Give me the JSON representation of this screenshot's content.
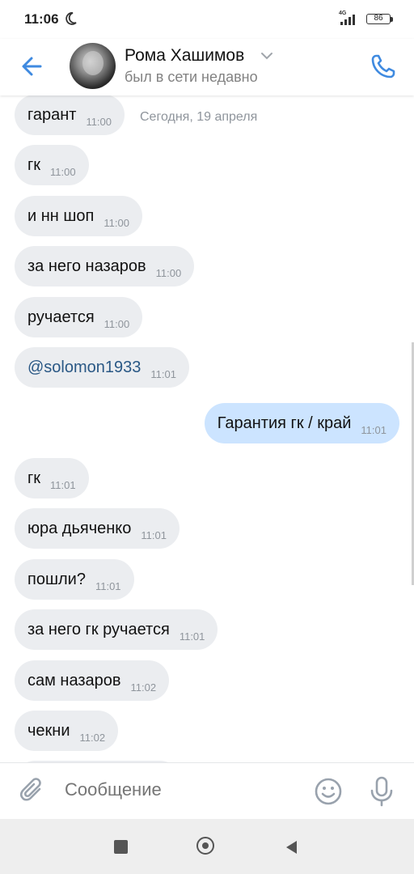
{
  "status_bar": {
    "time": "11:06",
    "network": "4G",
    "battery": "86",
    "battery_percent": 86,
    "icons": [
      "moon-icon",
      "signal-icon",
      "battery-icon"
    ]
  },
  "header": {
    "contact_name": "Рома Хашимов",
    "last_seen": "был в сети недавно",
    "icons": [
      "back-arrow-icon",
      "chevron-down-icon",
      "phone-icon"
    ],
    "accent_color": "#3f8ae0"
  },
  "chat": {
    "date_chip": "Сегодня, 19 апреля",
    "messages": [
      {
        "dir": "in",
        "text": "гарант",
        "time": "11:00",
        "link": false
      },
      {
        "dir": "in",
        "text": "гк",
        "time": "11:00",
        "link": false
      },
      {
        "dir": "in",
        "text": "и нн шоп",
        "time": "11:00",
        "link": false
      },
      {
        "dir": "in",
        "text": "за него назаров",
        "time": "11:00",
        "link": false
      },
      {
        "dir": "in",
        "text": "ручается",
        "time": "11:00",
        "link": false
      },
      {
        "dir": "in",
        "text": "@solomon1933",
        "time": "11:01",
        "link": true
      },
      {
        "dir": "out",
        "text": "Гарантия гк / край",
        "time": "11:01",
        "link": false
      },
      {
        "dir": "in",
        "text": "гк",
        "time": "11:01",
        "link": false
      },
      {
        "dir": "in",
        "text": "юра дьяченко",
        "time": "11:01",
        "link": false
      },
      {
        "dir": "in",
        "text": "пошли?",
        "time": "11:01",
        "link": false
      },
      {
        "dir": "in",
        "text": "за него гк ручается",
        "time": "11:01",
        "link": false
      },
      {
        "dir": "in",
        "text": "сам назаров",
        "time": "11:02",
        "link": false
      },
      {
        "dir": "in",
        "text": "чекни",
        "time": "11:02",
        "link": false
      }
    ],
    "incoming_bubble_color": "#ebedf0",
    "outgoing_bubble_color": "#cce4ff",
    "link_color": "#2a5885"
  },
  "composer": {
    "placeholder": "Сообщение",
    "icons": [
      "paperclip-icon",
      "emoji-icon",
      "microphone-icon"
    ]
  },
  "nav_bar": {
    "icons": [
      "recents-square-icon",
      "home-circle-icon",
      "back-triangle-icon"
    ]
  }
}
